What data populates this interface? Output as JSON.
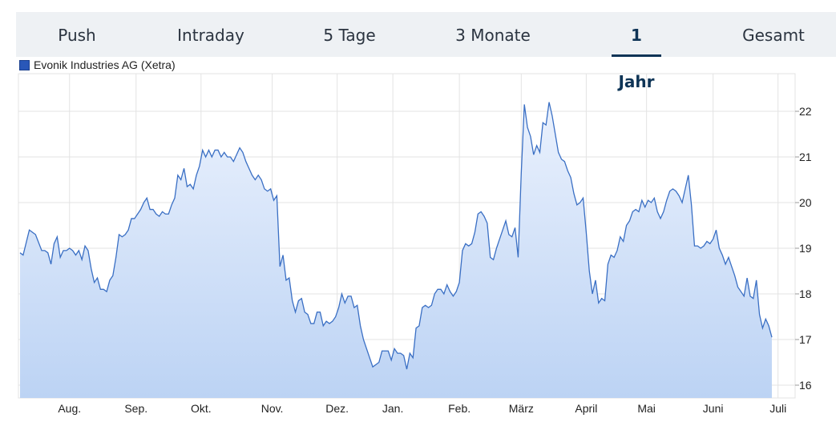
{
  "tabs": {
    "items": [
      "Push",
      "Intraday",
      "5 Tage",
      "3 Monate",
      "1 Jahr",
      "Gesamt"
    ],
    "active": "1 Jahr"
  },
  "colors": {
    "line": "#3a6fc4",
    "fill_top": "#eaf1fd",
    "fill_bottom": "#bcd3f4",
    "grid": "#e3e3e3",
    "legend_swatch": "#2957b8"
  },
  "chart_data": {
    "type": "area",
    "title": "",
    "xlabel": "",
    "ylabel": "",
    "series": [
      {
        "name": "Evonik Industries AG (Xetra)"
      }
    ],
    "ylim": [
      15.75,
      22.8
    ],
    "y_ticks": [
      16,
      17,
      18,
      19,
      20,
      21,
      22
    ],
    "x_ticks": [
      "Aug.",
      "Sep.",
      "Okt.",
      "Nov.",
      "Dez.",
      "Jan.",
      "Feb.",
      "März",
      "April",
      "Mai",
      "Juni",
      "Juli"
    ],
    "x_tick_positions": [
      16,
      37.5,
      58.5,
      81.5,
      102.5,
      120.5,
      142,
      162,
      183,
      202.5,
      224,
      245
    ],
    "x_range": [
      0,
      250
    ],
    "y_axis_position": "right",
    "grid": true,
    "legend_position": "top-left",
    "points": [
      [
        0,
        18.9
      ],
      [
        1,
        18.85
      ],
      [
        3,
        19.4
      ],
      [
        5,
        19.3
      ],
      [
        7,
        18.95
      ],
      [
        8,
        18.95
      ],
      [
        9,
        18.9
      ],
      [
        10,
        18.65
      ],
      [
        11,
        19.1
      ],
      [
        12,
        19.25
      ],
      [
        13,
        18.8
      ],
      [
        14,
        18.95
      ],
      [
        15,
        18.95
      ],
      [
        16,
        19.0
      ],
      [
        17,
        18.95
      ],
      [
        18,
        18.85
      ],
      [
        19,
        18.95
      ],
      [
        20,
        18.75
      ],
      [
        21,
        19.05
      ],
      [
        22,
        18.95
      ],
      [
        23,
        18.55
      ],
      [
        24,
        18.25
      ],
      [
        25,
        18.35
      ],
      [
        26,
        18.1
      ],
      [
        27,
        18.1
      ],
      [
        28,
        18.05
      ],
      [
        29,
        18.3
      ],
      [
        30,
        18.4
      ],
      [
        31,
        18.8
      ],
      [
        32,
        19.3
      ],
      [
        33,
        19.25
      ],
      [
        34,
        19.3
      ],
      [
        35,
        19.4
      ],
      [
        36,
        19.65
      ],
      [
        37,
        19.65
      ],
      [
        38,
        19.75
      ],
      [
        39,
        19.85
      ],
      [
        40,
        20.0
      ],
      [
        41,
        20.1
      ],
      [
        42,
        19.85
      ],
      [
        43,
        19.85
      ],
      [
        44,
        19.75
      ],
      [
        45,
        19.7
      ],
      [
        46,
        19.8
      ],
      [
        47,
        19.75
      ],
      [
        48,
        19.75
      ],
      [
        49,
        19.95
      ],
      [
        50,
        20.1
      ],
      [
        51,
        20.6
      ],
      [
        52,
        20.5
      ],
      [
        53,
        20.75
      ],
      [
        54,
        20.35
      ],
      [
        55,
        20.4
      ],
      [
        56,
        20.3
      ],
      [
        57,
        20.6
      ],
      [
        58,
        20.8
      ],
      [
        59,
        21.15
      ],
      [
        60,
        21.0
      ],
      [
        61,
        21.15
      ],
      [
        62,
        21.0
      ],
      [
        63,
        21.15
      ],
      [
        64,
        21.15
      ],
      [
        65,
        21.0
      ],
      [
        66,
        21.1
      ],
      [
        67,
        21.0
      ],
      [
        68,
        21.0
      ],
      [
        69,
        20.9
      ],
      [
        70,
        21.05
      ],
      [
        71,
        21.2
      ],
      [
        72,
        21.1
      ],
      [
        73,
        20.9
      ],
      [
        74,
        20.75
      ],
      [
        75,
        20.6
      ],
      [
        76,
        20.5
      ],
      [
        77,
        20.6
      ],
      [
        78,
        20.5
      ],
      [
        79,
        20.3
      ],
      [
        80,
        20.25
      ],
      [
        81,
        20.3
      ],
      [
        82,
        20.05
      ],
      [
        83,
        20.15
      ],
      [
        84,
        18.6
      ],
      [
        85,
        18.85
      ],
      [
        86,
        18.3
      ],
      [
        87,
        18.35
      ],
      [
        88,
        17.85
      ],
      [
        89,
        17.6
      ],
      [
        90,
        17.85
      ],
      [
        91,
        17.9
      ],
      [
        92,
        17.6
      ],
      [
        93,
        17.55
      ],
      [
        94,
        17.35
      ],
      [
        95,
        17.35
      ],
      [
        96,
        17.6
      ],
      [
        97,
        17.6
      ],
      [
        98,
        17.3
      ],
      [
        99,
        17.4
      ],
      [
        100,
        17.35
      ],
      [
        101,
        17.4
      ],
      [
        102,
        17.5
      ],
      [
        103,
        17.7
      ],
      [
        104,
        18.0
      ],
      [
        105,
        17.8
      ],
      [
        106,
        17.95
      ],
      [
        107,
        17.95
      ],
      [
        108,
        17.7
      ],
      [
        109,
        17.75
      ],
      [
        110,
        17.3
      ],
      [
        111,
        17.0
      ],
      [
        112,
        16.8
      ],
      [
        113,
        16.6
      ],
      [
        114,
        16.4
      ],
      [
        115,
        16.45
      ],
      [
        116,
        16.5
      ],
      [
        117,
        16.75
      ],
      [
        118,
        16.75
      ],
      [
        119,
        16.75
      ],
      [
        120,
        16.55
      ],
      [
        121,
        16.8
      ],
      [
        122,
        16.7
      ],
      [
        123,
        16.7
      ],
      [
        124,
        16.65
      ],
      [
        125,
        16.35
      ],
      [
        126,
        16.7
      ],
      [
        127,
        16.6
      ],
      [
        128,
        17.25
      ],
      [
        129,
        17.3
      ],
      [
        130,
        17.7
      ],
      [
        131,
        17.75
      ],
      [
        132,
        17.7
      ],
      [
        133,
        17.75
      ],
      [
        134,
        18.0
      ],
      [
        135,
        18.1
      ],
      [
        136,
        18.1
      ],
      [
        137,
        18.0
      ],
      [
        138,
        18.2
      ],
      [
        139,
        18.05
      ],
      [
        140,
        17.95
      ],
      [
        141,
        18.05
      ],
      [
        142,
        18.25
      ],
      [
        143,
        18.95
      ],
      [
        144,
        19.1
      ],
      [
        145,
        19.05
      ],
      [
        146,
        19.1
      ],
      [
        147,
        19.35
      ],
      [
        148,
        19.75
      ],
      [
        149,
        19.8
      ],
      [
        150,
        19.7
      ],
      [
        151,
        19.55
      ],
      [
        152,
        18.8
      ],
      [
        153,
        18.75
      ],
      [
        154,
        19.0
      ],
      [
        155,
        19.2
      ],
      [
        156,
        19.4
      ],
      [
        157,
        19.6
      ],
      [
        158,
        19.3
      ],
      [
        159,
        19.25
      ],
      [
        160,
        19.45
      ],
      [
        161,
        18.8
      ],
      [
        162,
        20.65
      ],
      [
        163,
        22.15
      ],
      [
        164,
        21.65
      ],
      [
        165,
        21.45
      ],
      [
        166,
        21.05
      ],
      [
        167,
        21.25
      ],
      [
        168,
        21.1
      ],
      [
        169,
        21.75
      ],
      [
        170,
        21.7
      ],
      [
        171,
        22.2
      ],
      [
        172,
        21.9
      ],
      [
        173,
        21.5
      ],
      [
        174,
        21.1
      ],
      [
        175,
        20.95
      ],
      [
        176,
        20.9
      ],
      [
        177,
        20.7
      ],
      [
        178,
        20.55
      ],
      [
        179,
        20.2
      ],
      [
        180,
        19.95
      ],
      [
        181,
        20.0
      ],
      [
        182,
        20.1
      ],
      [
        183,
        19.35
      ],
      [
        184,
        18.5
      ],
      [
        185,
        18.0
      ],
      [
        186,
        18.3
      ],
      [
        187,
        17.8
      ],
      [
        188,
        17.9
      ],
      [
        189,
        17.85
      ],
      [
        190,
        18.65
      ],
      [
        191,
        18.85
      ],
      [
        192,
        18.8
      ],
      [
        193,
        18.95
      ],
      [
        194,
        19.25
      ],
      [
        195,
        19.15
      ],
      [
        196,
        19.5
      ],
      [
        197,
        19.6
      ],
      [
        198,
        19.8
      ],
      [
        199,
        19.85
      ],
      [
        200,
        19.8
      ],
      [
        201,
        20.05
      ],
      [
        202,
        19.9
      ],
      [
        203,
        20.05
      ],
      [
        204,
        20.0
      ],
      [
        205,
        20.1
      ],
      [
        206,
        19.8
      ],
      [
        207,
        19.65
      ],
      [
        208,
        19.8
      ],
      [
        209,
        20.05
      ],
      [
        210,
        20.25
      ],
      [
        211,
        20.3
      ],
      [
        212,
        20.25
      ],
      [
        213,
        20.15
      ],
      [
        214,
        20.0
      ],
      [
        215,
        20.3
      ],
      [
        216,
        20.6
      ],
      [
        217,
        19.95
      ],
      [
        218,
        19.05
      ],
      [
        219,
        19.05
      ],
      [
        220,
        19.0
      ],
      [
        221,
        19.05
      ],
      [
        222,
        19.15
      ],
      [
        223,
        19.1
      ],
      [
        224,
        19.2
      ],
      [
        225,
        19.4
      ],
      [
        226,
        19.0
      ],
      [
        227,
        18.85
      ],
      [
        228,
        18.65
      ],
      [
        229,
        18.8
      ],
      [
        230,
        18.6
      ],
      [
        231,
        18.4
      ],
      [
        232,
        18.15
      ],
      [
        233,
        18.05
      ],
      [
        234,
        17.95
      ],
      [
        235,
        18.35
      ],
      [
        236,
        17.95
      ],
      [
        237,
        17.9
      ],
      [
        238,
        18.3
      ],
      [
        239,
        17.55
      ],
      [
        240,
        17.25
      ],
      [
        241,
        17.45
      ],
      [
        242,
        17.3
      ],
      [
        243,
        17.05
      ]
    ]
  }
}
